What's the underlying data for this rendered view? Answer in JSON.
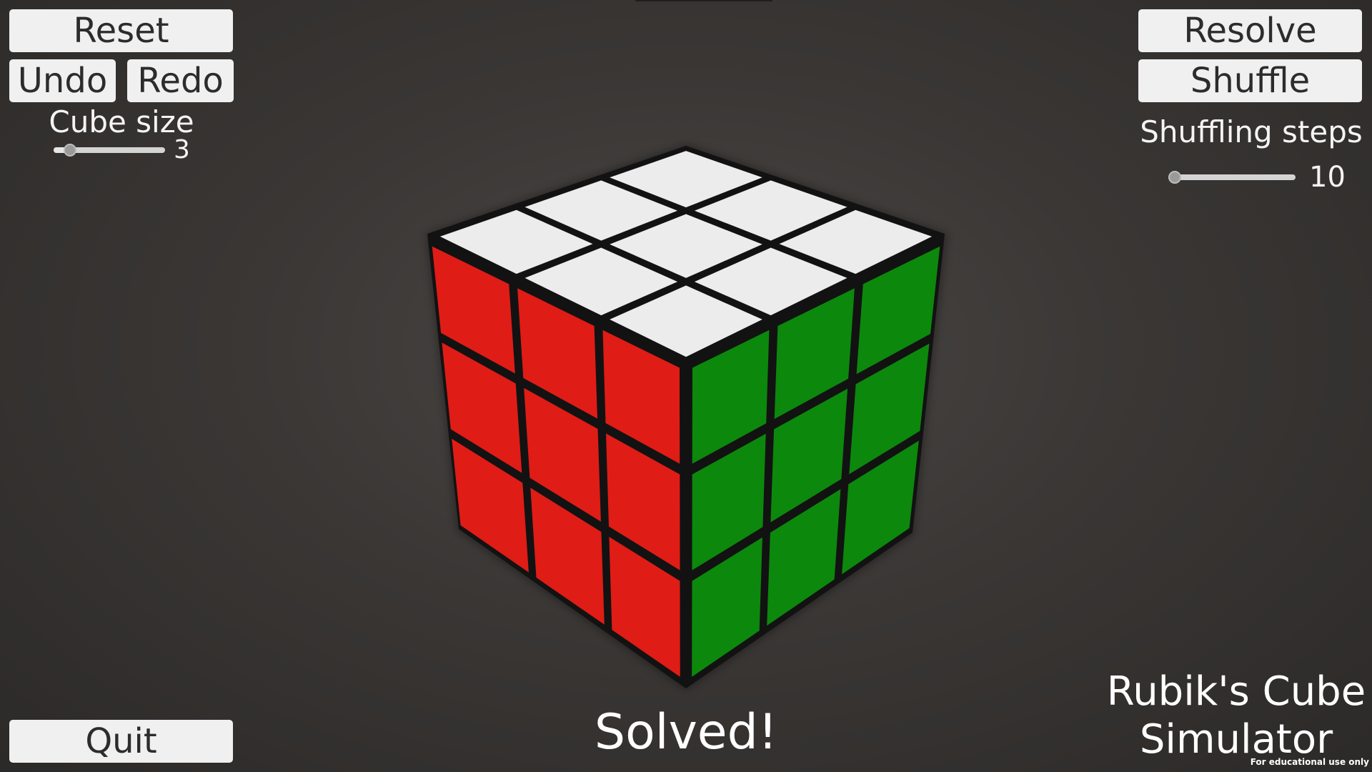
{
  "controls": {
    "reset_label": "Reset",
    "undo_label": "Undo",
    "redo_label": "Redo",
    "quit_label": "Quit",
    "resolve_label": "Resolve",
    "shuffle_label": "Shuffle"
  },
  "cube_size": {
    "label": "Cube size",
    "value": "3",
    "slider_fraction": 0.15
  },
  "shuffling_steps": {
    "label": "Shuffling steps",
    "value": "10",
    "slider_fraction": 0.05
  },
  "status": {
    "text": "Solved!"
  },
  "title": {
    "line1": "Rubik's Cube",
    "line2": "Simulator"
  },
  "footer": {
    "note": "For educational use only"
  },
  "cube": {
    "size": 3,
    "faces": {
      "top": "white",
      "left": "red",
      "right": "green"
    }
  },
  "colors": {
    "background": "#3a3735",
    "white_face": "#ececec",
    "red_face": "#e01c16",
    "green_face": "#0c880c",
    "button_bg": "#f0f0f0",
    "button_text": "#2c2c2c"
  }
}
